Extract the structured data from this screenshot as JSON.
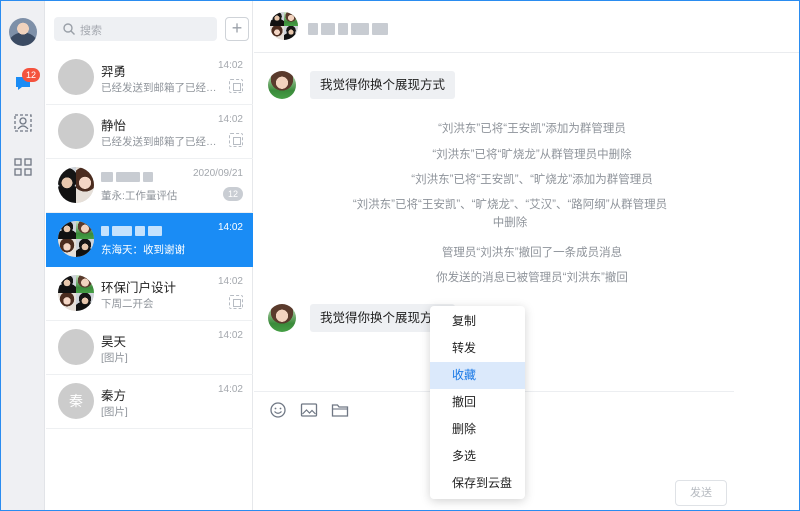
{
  "rail": {
    "badge_count": "12"
  },
  "search": {
    "placeholder": "搜索",
    "add_label": "+"
  },
  "conversations": [
    {
      "name": "羿勇",
      "time": "14:02",
      "preview": "已经发送到邮箱了已经发送..."
    },
    {
      "name": "静怡",
      "time": "14:02",
      "preview": "已经发送到邮箱了已经发送..."
    },
    {
      "name": "",
      "time": "2020/09/21",
      "preview": "董永:工作量评估",
      "count": "12"
    },
    {
      "name": "",
      "time": "14:02",
      "preview": "东海天：收到谢谢"
    },
    {
      "name": "环保门户设计",
      "time": "14:02",
      "preview": "下周二开会"
    },
    {
      "name": "昊天",
      "time": "14:02",
      "preview": "[图片]"
    },
    {
      "name": "秦方",
      "time": "14:02",
      "preview": "[图片]",
      "avatar_letter": "秦"
    }
  ],
  "chat": {
    "messages": [
      {
        "text": "我觉得你换个展现方式"
      },
      {
        "text": "我觉得你换个展现方式"
      }
    ],
    "system_notices": [
      "“刘洪东”已将“王安凯”添加为群管理员",
      "“刘洪东”已将“旷烧龙”从群管理员中删除",
      "“刘洪东”已将“王安凯”、“旷烧龙”添加为群管理员",
      "“刘洪东”已将“王安凯”、“旷烧龙”、“艾汉”、“路阿纲”从群管理员中删除",
      "管理员“刘洪东”撤回了一条成员消息",
      "你发送的消息已被管理员“刘洪东”撤回"
    ],
    "send_label": "发送"
  },
  "context_menu": {
    "items": [
      "复制",
      "转发",
      "收藏",
      "撤回",
      "删除",
      "多选",
      "保存到云盘"
    ],
    "highlighted": "收藏"
  },
  "colors": {
    "accent": "#1a8cf5",
    "badge": "#f4533e",
    "highlight": "#dbe9fb"
  }
}
